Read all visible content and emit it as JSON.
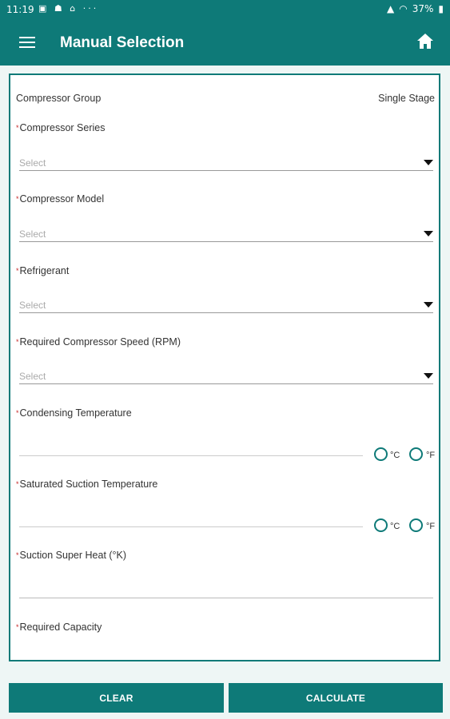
{
  "status_bar": {
    "time": "11:19",
    "battery": "37%"
  },
  "app_bar": {
    "title": "Manual Selection"
  },
  "form": {
    "compressor_group": {
      "label": "Compressor Group",
      "value": "Single Stage"
    },
    "compressor_series": {
      "label": "Compressor Series",
      "placeholder": "Select"
    },
    "compressor_model": {
      "label": "Compressor Model",
      "placeholder": "Select"
    },
    "refrigerant": {
      "label": "Refrigerant",
      "placeholder": "Select"
    },
    "compressor_speed": {
      "label": "Required Compressor Speed (RPM)",
      "placeholder": "Select"
    },
    "condensing_temperature": {
      "label": "Condensing Temperature",
      "unit_c": "°C",
      "unit_f": "°F"
    },
    "saturated_suction_temperature": {
      "label": "Saturated Suction Temperature",
      "unit_c": "°C",
      "unit_f": "°F"
    },
    "suction_super_heat": {
      "label": "Suction Super Heat (°K)"
    },
    "required_capacity": {
      "label": "Required Capacity"
    },
    "required_marker": "*"
  },
  "buttons": {
    "clear": "CLEAR",
    "calculate": "CALCULATE"
  },
  "colors": {
    "primary": "#0e7a78",
    "required": "#c62828"
  }
}
